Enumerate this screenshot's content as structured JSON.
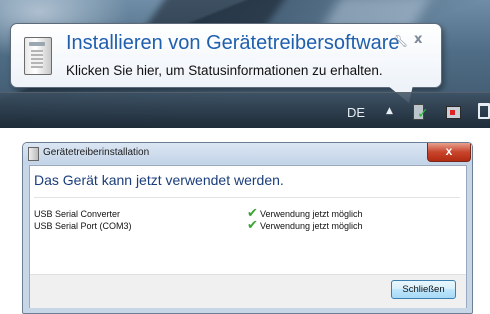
{
  "notification": {
    "title": "Installieren von Gerätetreibersoftware",
    "text": "Klicken Sie hier, um Statusinformationen zu erhalten.",
    "settings_icon": "wrench-icon",
    "close_icon": "x"
  },
  "taskbar": {
    "language": "DE",
    "show_hidden_icon": "▲"
  },
  "dialog": {
    "title": "Gerätetreiberinstallation",
    "close_glyph": "x",
    "headline": "Das Gerät kann jetzt verwendet werden.",
    "devices": [
      {
        "name": "USB Serial Converter",
        "status": "Verwendung jetzt möglich",
        "icon": "checkmark-icon"
      },
      {
        "name": "USB Serial Port (COM3)",
        "status": "Verwendung jetzt möglich",
        "icon": "checkmark-icon"
      }
    ],
    "close_button": "Schließen"
  },
  "colors": {
    "title_blue": "#1f5fae",
    "headline_blue": "#1a3d7c",
    "check_green": "#3aa431",
    "close_red": "#c8452c"
  }
}
